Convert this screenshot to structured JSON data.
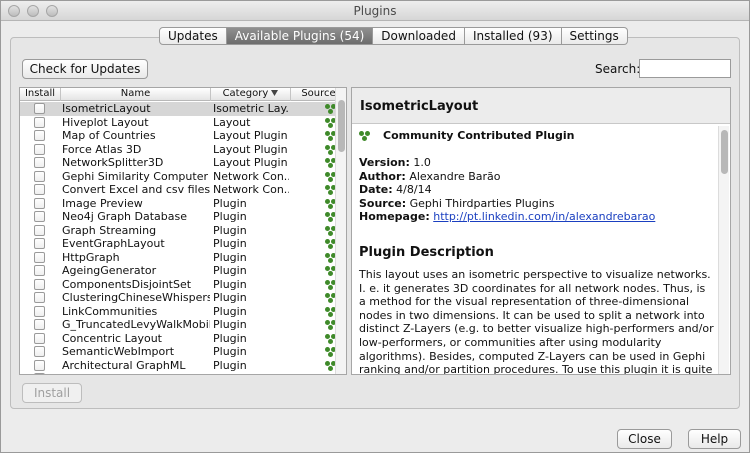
{
  "window": {
    "title": "Plugins"
  },
  "tabs": [
    {
      "label": "Updates",
      "active": false
    },
    {
      "label": "Available Plugins (54)",
      "active": true
    },
    {
      "label": "Downloaded",
      "active": false
    },
    {
      "label": "Installed (93)",
      "active": false
    },
    {
      "label": "Settings",
      "active": false
    }
  ],
  "toolbar": {
    "check_updates_label": "Check for Updates",
    "search_label": "Search:",
    "search_value": ""
  },
  "table": {
    "headers": {
      "install": "Install",
      "name": "Name",
      "category": "Category",
      "source": "Source"
    },
    "sort_icon": "sort-descending-icon",
    "rows": [
      {
        "name": "IsometricLayout",
        "category": "Isometric Lay...",
        "selected": true
      },
      {
        "name": "Hiveplot Layout",
        "category": "Layout"
      },
      {
        "name": "Map of Countries",
        "category": "Layout Plugin"
      },
      {
        "name": "Force Atlas 3D",
        "category": "Layout Plugin"
      },
      {
        "name": "NetworkSplitter3D",
        "category": "Layout Plugin"
      },
      {
        "name": "Gephi Similarity Computer",
        "category": "Network Con..."
      },
      {
        "name": "Convert Excel and csv files t...",
        "category": "Network Con..."
      },
      {
        "name": "Image Preview",
        "category": "Plugin"
      },
      {
        "name": "Neo4j Graph Database",
        "category": "Plugin"
      },
      {
        "name": "Graph Streaming",
        "category": "Plugin"
      },
      {
        "name": "EventGraphLayout",
        "category": "Plugin"
      },
      {
        "name": "HttpGraph",
        "category": "Plugin"
      },
      {
        "name": "AgeingGenerator",
        "category": "Plugin"
      },
      {
        "name": "ComponentsDisjointSet",
        "category": "Plugin"
      },
      {
        "name": "ClusteringChineseWhispers",
        "category": "Plugin"
      },
      {
        "name": "LinkCommunities",
        "category": "Plugin"
      },
      {
        "name": "G_TruncatedLevyWalkMobilit...",
        "category": "Plugin"
      },
      {
        "name": "Concentric Layout",
        "category": "Plugin"
      },
      {
        "name": "SemanticWebImport",
        "category": "Plugin"
      },
      {
        "name": "Architectural GraphML",
        "category": "Plugin"
      },
      {
        "name": "",
        "category": ""
      }
    ]
  },
  "detail": {
    "title": "IsometricLayout",
    "source_badge": "Community Contributed Plugin",
    "version_label": "Version:",
    "version": "1.0",
    "author_label": "Author:",
    "author": "Alexandre Barão",
    "date_label": "Date:",
    "date": "4/8/14",
    "source_label": "Source:",
    "source": "Gephi Thirdparties Plugins",
    "homepage_label": "Homepage:",
    "homepage": "http://pt.linkedin.com/in/alexandrebarao",
    "description_title": "Plugin Description",
    "description": "This layout uses an isometric perspective to visualize networks. I. e. it generates 3D coordinates for all network nodes. Thus, is a method for the visual representation of three-dimensional nodes in two dimensions. It can be used to split a network into distinct Z-Layers (e.g. to better visualize high-performers and/or low-performers, or communities after using modularity algorithms). Besides, computed Z-Layers can be used in Gephi ranking and/or partition procedures. To use this plugin it is quite simple: network"
  },
  "footer": {
    "install_label": "Install",
    "close_label": "Close",
    "help_label": "Help"
  }
}
